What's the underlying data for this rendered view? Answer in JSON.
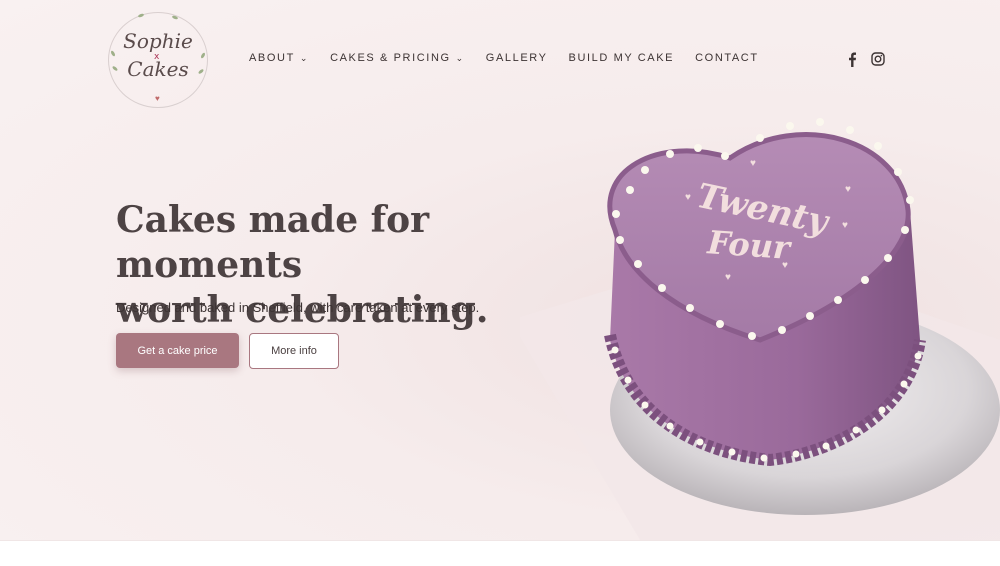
{
  "brand": {
    "logo_line1": "Sophie",
    "logo_line2": "Cakes",
    "logo_x": "x"
  },
  "nav": {
    "items": [
      {
        "label": "ABOUT",
        "has_dropdown": true
      },
      {
        "label": "CAKES & PRICING",
        "has_dropdown": true
      },
      {
        "label": "GALLERY",
        "has_dropdown": false
      },
      {
        "label": "BUILD MY CAKE",
        "has_dropdown": false
      },
      {
        "label": "CONTACT",
        "has_dropdown": false
      }
    ],
    "social": [
      {
        "icon": "facebook-icon",
        "glyph": "f"
      },
      {
        "icon": "instagram-icon",
        "glyph": ""
      }
    ]
  },
  "hero": {
    "headline_line1": "Cakes made for moments",
    "headline_line2": "worth celebrating.",
    "subtext": "Designed and baked in Sheffield, with care taken at every step.",
    "primary_button": "Get a cake price",
    "secondary_button": "More info",
    "cake_text_line1": "Twenty",
    "cake_text_line2": "Four"
  },
  "colors": {
    "accent": "#a97780",
    "text": "#4d4344",
    "background": "#f7eeee",
    "cake": "#9d6f9e"
  }
}
